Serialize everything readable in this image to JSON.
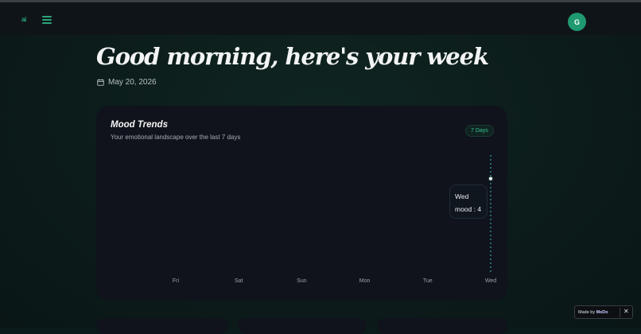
{
  "header": {
    "logo_text": "ai",
    "menu_icon": "hamburger-menu-icon",
    "avatar_initial": "G",
    "avatar_color": "#1f9a70"
  },
  "main": {
    "greeting": "Good morning, here's your week",
    "date_icon": "calendar-icon",
    "date": "May 20, 2026"
  },
  "mood_card": {
    "title": "Mood Trends",
    "subtitle": "Your emotional landscape over the last 7 days",
    "range_label": "7 Days",
    "tooltip": {
      "day": "Wed",
      "line": "mood : 4"
    }
  },
  "chart_data": {
    "type": "line",
    "title": "Mood Trends",
    "categories": [
      "Fri",
      "Sat",
      "Sun",
      "Mon",
      "Tue",
      "Wed"
    ],
    "series": [
      {
        "name": "mood",
        "values": [
          null,
          null,
          null,
          null,
          null,
          4
        ]
      }
    ],
    "ylim": [
      0,
      5
    ],
    "grid": false,
    "active_category": "Wed",
    "accent": "#34c3b0"
  },
  "badge": {
    "made_by_label": "Made by",
    "brand": "MeDo",
    "close_icon": "close-icon"
  },
  "colors": {
    "accent": "#2aa57a",
    "card_bg": "#10131c",
    "page_bg": "#0b1a1a"
  }
}
